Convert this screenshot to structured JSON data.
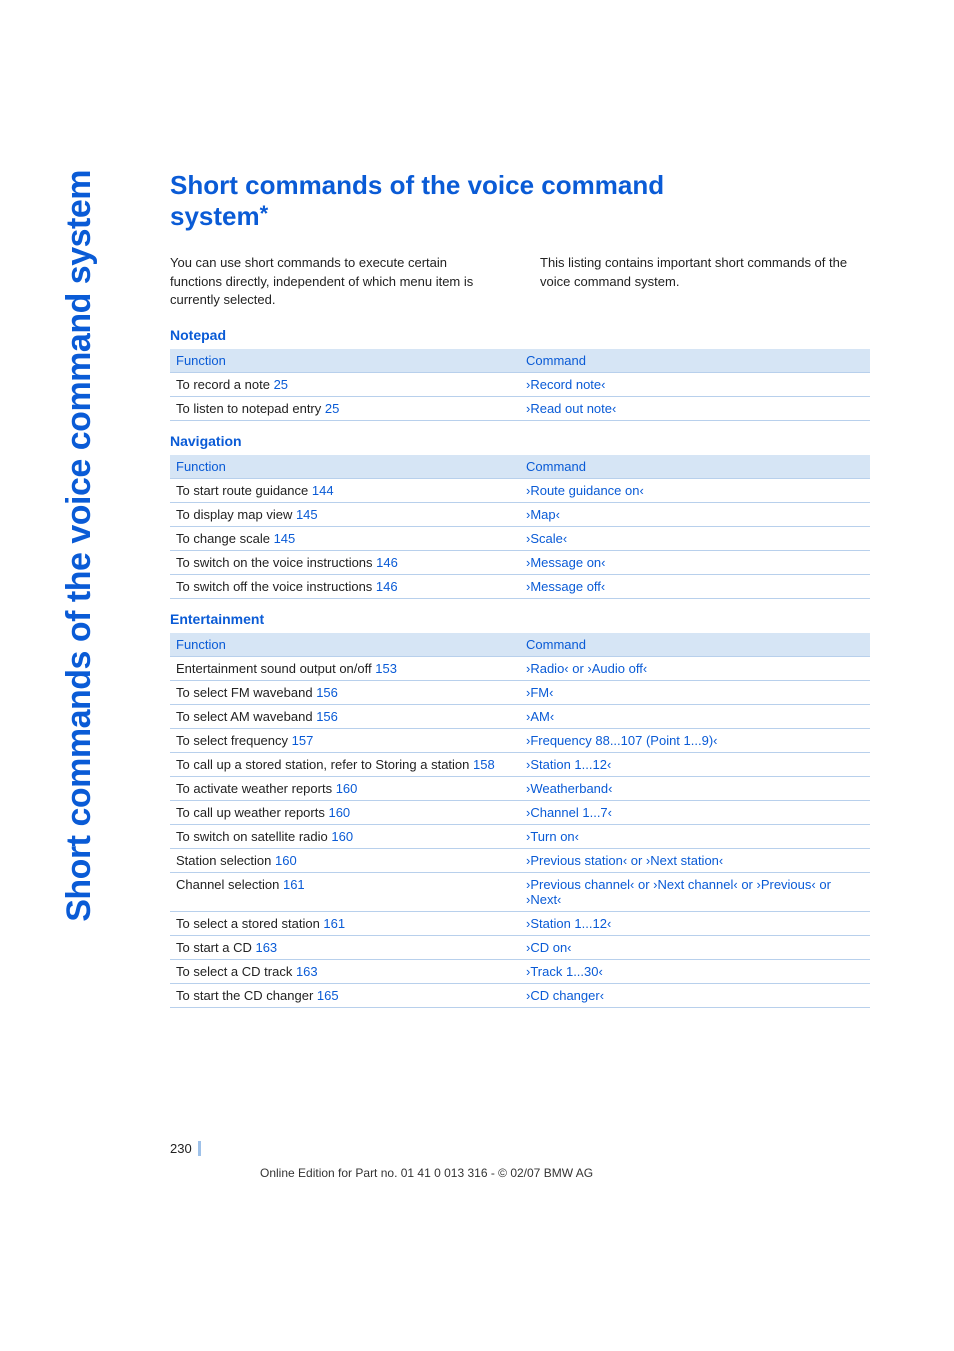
{
  "sideTab": "Short commands of the voice command system",
  "title_line1": "Short commands of the voice command",
  "title_line2": "system",
  "intro_left": "You can use short commands to execute certain functions directly, independent of which menu item is currently selected.",
  "intro_right": "This listing contains important short commands of the voice command system.",
  "headers": {
    "func": "Function",
    "cmd": "Command"
  },
  "notepad": {
    "title": "Notepad",
    "rows": [
      {
        "func": "To record a note",
        "ref": "25",
        "cmd": "›Record note‹"
      },
      {
        "func": "To listen to notepad entry",
        "ref": "25",
        "cmd": "›Read out note‹"
      }
    ]
  },
  "navigation": {
    "title": "Navigation",
    "rows": [
      {
        "func": "To start route guidance",
        "ref": "144",
        "cmd": "›Route guidance on‹"
      },
      {
        "func": "To display map view",
        "ref": "145",
        "cmd": "›Map‹"
      },
      {
        "func": "To change scale",
        "ref": "145",
        "cmd": "›Scale‹"
      },
      {
        "func": "To switch on the voice instructions",
        "ref": "146",
        "cmd": "›Message on‹"
      },
      {
        "func": "To switch off the voice instructions",
        "ref": "146",
        "cmd": "›Message off‹"
      }
    ]
  },
  "entertainment": {
    "title": "Entertainment",
    "rows": [
      {
        "func": "Entertainment sound output on/off",
        "ref": "153",
        "cmd": "›Radio‹ or ›Audio off‹"
      },
      {
        "func": "To select FM waveband",
        "ref": "156",
        "cmd": "›FM‹"
      },
      {
        "func": "To select AM waveband",
        "ref": "156",
        "cmd": "›AM‹"
      },
      {
        "func": "To select frequency",
        "ref": "157",
        "cmd": "›Frequency 88...107 (Point 1...9)‹"
      },
      {
        "func": "To call up a stored station, refer to Storing a station",
        "ref": "158",
        "cmd": "›Station 1...12‹"
      },
      {
        "func": "To activate weather reports",
        "ref": "160",
        "cmd": "›Weatherband‹"
      },
      {
        "func": "To call up weather reports",
        "ref": "160",
        "cmd": "›Channel 1...7‹"
      },
      {
        "func": "To switch on satellite radio",
        "ref": "160",
        "cmd": "›Turn on‹"
      },
      {
        "func": "Station selection",
        "ref": "160",
        "cmd": "›Previous station‹ or ›Next station‹"
      },
      {
        "func": "Channel selection",
        "ref": "161",
        "cmd": "›Previous channel‹ or ›Next channel‹ or ›Previous‹ or ›Next‹"
      },
      {
        "func": "To select a stored station",
        "ref": "161",
        "cmd": "›Station 1...12‹"
      },
      {
        "func": "To start a CD",
        "ref": "163",
        "cmd": "›CD on‹"
      },
      {
        "func": "To select a CD track",
        "ref": "163",
        "cmd": "›Track 1...30‹"
      },
      {
        "func": "To start the CD changer",
        "ref": "165",
        "cmd": "›CD changer‹"
      }
    ]
  },
  "page_number": "230",
  "footer_note": "Online Edition for Part no. 01 41 0 013 316 - © 02/07 BMW AG"
}
